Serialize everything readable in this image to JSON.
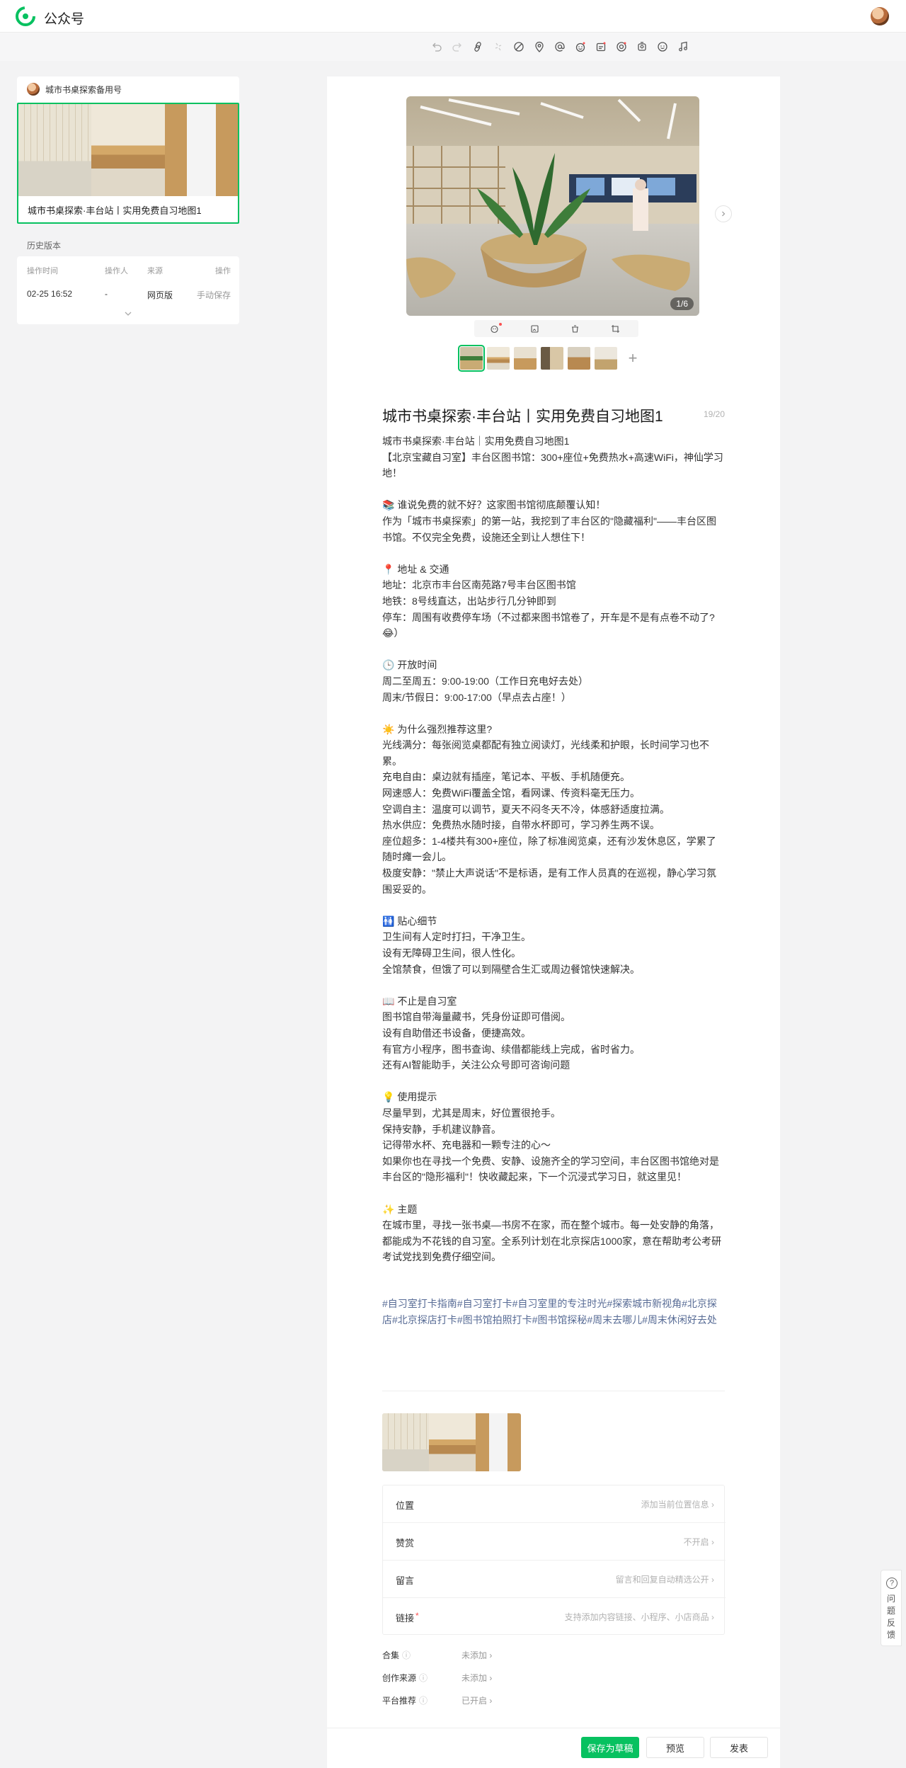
{
  "app": {
    "title": "公众号"
  },
  "toolbar": {
    "icons": [
      "undo-icon",
      "redo-icon",
      "link-icon",
      "unlink-icon",
      "no-icon",
      "location-icon",
      "mention-icon",
      "emoji-icon",
      "sticker-icon",
      "gift-icon",
      "contact-icon",
      "smile-icon",
      "music-icon"
    ]
  },
  "draft": {
    "account_name": "城市书桌探索备用号",
    "title": "城市书桌探索·丰台站丨实用免费自习地图1"
  },
  "history": {
    "label": "历史版本",
    "columns": [
      "操作时间",
      "操作人",
      "来源",
      "操作"
    ],
    "rows": [
      {
        "time": "02-25 16:52",
        "operator": "-",
        "source": "网页版",
        "action": "手动保存"
      }
    ]
  },
  "editor": {
    "hero_counter": "1/6",
    "thumb_count": 6,
    "title": "城市书桌探索·丰台站丨实用免费自习地图1",
    "title_count": "19/20",
    "body_lines": [
      "城市书桌探索·丰台站｜实用免费自习地图1",
      "【北京宝藏自习室】丰台区图书馆：300+座位+免费热水+高速WiFi，神仙学习地！",
      "",
      "📚 谁说免费的就不好？这家图书馆彻底颠覆认知！",
      "作为「城市书桌探索」的第一站，我挖到了丰台区的\"隐藏福利\"——丰台区图书馆。不仅完全免费，设施还全到让人想住下！",
      "",
      "📍 地址 & 交通",
      "地址：北京市丰台区南苑路7号丰台区图书馆",
      "地铁：8号线直达，出站步行几分钟即到",
      "停车：周围有收费停车场（不过都来图书馆卷了，开车是不是有点卷不动了?😂）",
      "",
      "🕒 开放时间",
      "周二至周五：9:00-19:00（工作日充电好去处）",
      "周末/节假日：9:00-17:00（早点去占座！）",
      "",
      "☀️ 为什么强烈推荐这里?",
      "光线满分：每张阅览桌都配有独立阅读灯，光线柔和护眼，长时间学习也不累。",
      "充电自由：桌边就有插座，笔记本、平板、手机随便充。",
      "网速感人：免费WiFi覆盖全馆，看网课、传资料毫无压力。",
      "空调自主：温度可以调节，夏天不闷冬天不冷，体感舒适度拉满。",
      "热水供应：免费热水随时接，自带水杯即可，学习养生两不误。",
      "座位超多：1-4楼共有300+座位，除了标准阅览桌，还有沙发休息区，学累了随时瘫一会儿。",
      "极度安静：\"禁止大声说话\"不是标语，是有工作人员真的在巡视，静心学习氛围妥妥的。",
      "",
      "🚻 贴心细节",
      "卫生间有人定时打扫，干净卫生。",
      "设有无障碍卫生间，很人性化。",
      "全馆禁食，但饿了可以到隔壁合生汇或周边餐馆快速解决。",
      "",
      "📖 不止是自习室",
      "图书馆自带海量藏书，凭身份证即可借阅。",
      "设有自助借还书设备，便捷高效。",
      "有官方小程序，图书查询、续借都能线上完成，省时省力。",
      "还有AI智能助手，关注公众号即可咨询问题",
      "",
      "💡 使用提示",
      "尽量早到，尤其是周末，好位置很抢手。",
      "保持安静，手机建议静音。",
      "记得带水杯、充电器和一颗专注的心～",
      "如果你也在寻找一个免费、安静、设施齐全的学习空间，丰台区图书馆绝对是丰台区的\"隐形福利\"！快收藏起来，下一个沉浸式学习日，就这里见！",
      "",
      "✨ 主题",
      "在城市里，寻找一张书桌—书房不在家，而在整个城市。每一处安静的角落，都能成为不花钱的自习室。全系列计划在北京探店1000家，意在帮助考公考研考试党找到免费仔细空间。"
    ],
    "tags": "#自习室打卡指南#自习室打卡#自习室里的专注时光#探索城市新视角#北京探店#北京探店打卡#图书馆拍照打卡#图书馆探秘#周末去哪儿#周末休闲好去处",
    "settings": [
      {
        "label": "位置",
        "value": "添加当前位置信息 ›",
        "required": false
      },
      {
        "label": "赞赏",
        "value": "不开启 ›",
        "required": false
      },
      {
        "label": "留言",
        "value": "留言和回复自动精选公开 ›",
        "required": false
      },
      {
        "label": "链接",
        "value": "支持添加内容链接、小程序、小店商品 ›",
        "required": true
      }
    ],
    "meta": [
      {
        "label": "合集",
        "value": "未添加 ›"
      },
      {
        "label": "创作来源",
        "value": "未添加 ›"
      },
      {
        "label": "平台推荐",
        "value": "已开启 ›"
      }
    ],
    "buttons": {
      "save": "保存为草稿",
      "preview": "预览",
      "publish": "发表"
    }
  },
  "feedback": {
    "label": "问题反馈",
    "icon": "help-icon"
  },
  "colors": {
    "accent": "#07c160",
    "tag": "#576b95",
    "required": "#fa5151"
  }
}
